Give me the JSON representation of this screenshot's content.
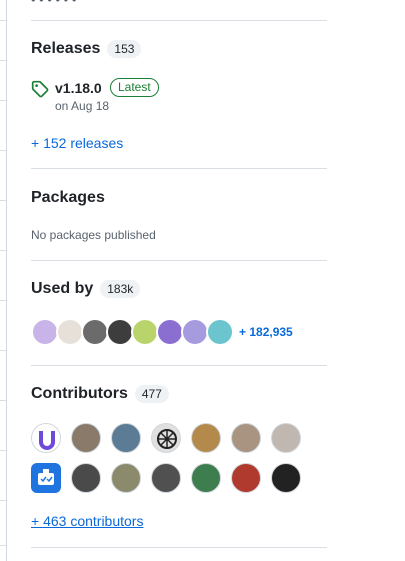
{
  "top_clipped_text": "• • •   • • •",
  "releases": {
    "title": "Releases",
    "count": "153",
    "latest": {
      "name": "v1.18.0",
      "badge": "Latest",
      "date": "on Aug 18"
    },
    "more_link": "+ 152 releases"
  },
  "packages": {
    "title": "Packages",
    "empty_text": "No packages published"
  },
  "used_by": {
    "title": "Used by",
    "count": "183k",
    "more_link": "+ 182,935",
    "avatars": [
      {
        "icon": "purple-pixel-avatar",
        "color": "#c8b4e8"
      },
      {
        "icon": "person-avatar",
        "color": "#e6e0d8"
      },
      {
        "icon": "grayscale-photo-avatar",
        "color": "#6b6b6b"
      },
      {
        "icon": "dark-photo-avatar",
        "color": "#3d3d3d"
      },
      {
        "icon": "green-identicon-avatar",
        "color": "#b9d46a"
      },
      {
        "icon": "purple-identicon-avatar",
        "color": "#8b6fd0"
      },
      {
        "icon": "violet-identicon-avatar",
        "color": "#a79be0"
      },
      {
        "icon": "teal-identicon-avatar",
        "color": "#6cc4cf"
      }
    ]
  },
  "contributors": {
    "title": "Contributors",
    "count": "477",
    "more_link": "+ 463 contributors",
    "avatars": [
      {
        "icon": "purple-logo-avatar",
        "color": "#6e4ad8"
      },
      {
        "icon": "bearded-man-avatar",
        "color": "#8a7a6a"
      },
      {
        "icon": "landscape-avatar",
        "color": "#5c7b94"
      },
      {
        "icon": "mono-pattern-avatar",
        "color": "#e0e0e0"
      },
      {
        "icon": "monkey-avatar",
        "color": "#b48a4c"
      },
      {
        "icon": "smiling-man-avatar",
        "color": "#a89480"
      },
      {
        "icon": "man-portrait-avatar",
        "color": "#c0b8b0"
      },
      {
        "icon": "bot-avatar",
        "color": "#1f74e0"
      },
      {
        "icon": "man-dark-avatar",
        "color": "#4a4a4a"
      },
      {
        "icon": "outdoor-avatar",
        "color": "#8c8a6c"
      },
      {
        "icon": "bw-portrait-avatar",
        "color": "#505050"
      },
      {
        "icon": "green-shirt-avatar",
        "color": "#3e7d4e"
      },
      {
        "icon": "red-art-avatar",
        "color": "#b03a2e"
      },
      {
        "icon": "glasses-man-avatar",
        "color": "#222222"
      }
    ]
  }
}
